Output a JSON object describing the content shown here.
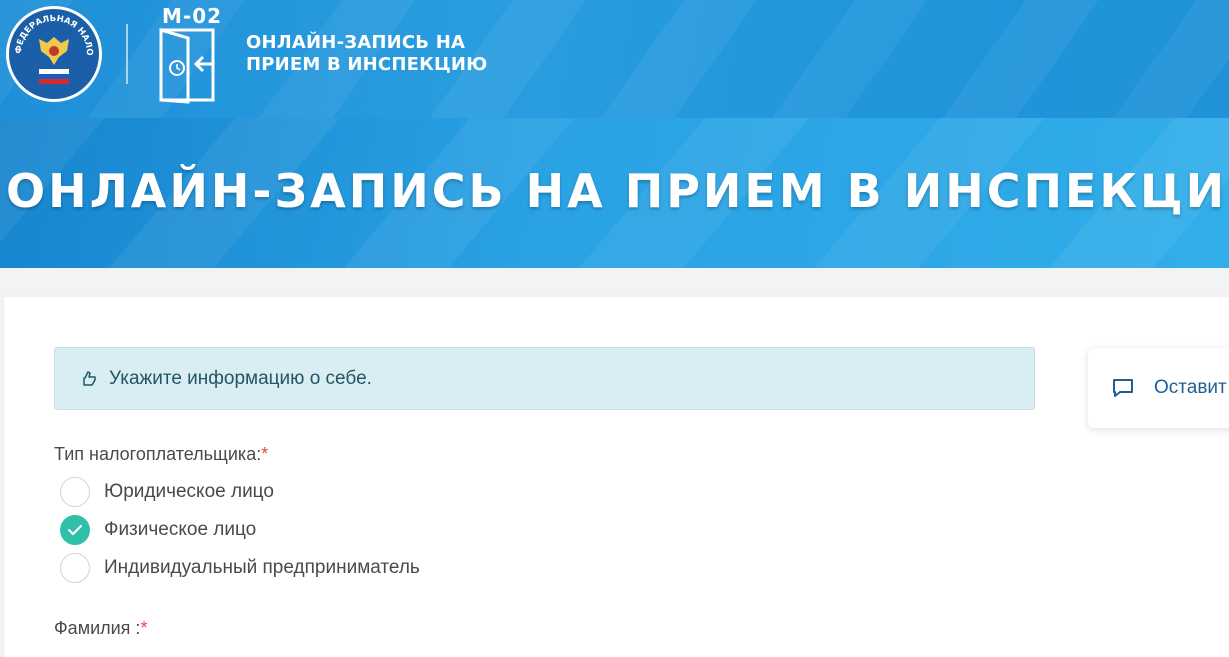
{
  "header": {
    "emblem_text": "ФЕДЕРАЛЬНАЯ НАЛОГОВАЯ СЛУЖБА",
    "service_code": "М-02",
    "service_name_line1": "ОНЛАЙН-ЗАПИСЬ НА",
    "service_name_line2": "ПРИЕМ В ИНСПЕКЦИЮ"
  },
  "banner": {
    "title": "ОНЛАЙН-ЗАПИСЬ НА ПРИЕМ В ИНСПЕКЦИЮ"
  },
  "form": {
    "info_message": "Укажите информацию о себе.",
    "taxpayer_type_label": "Тип налогоплательщика:",
    "required_mark": "*",
    "taxpayer_options": [
      {
        "label": "Юридическое лицо",
        "checked": false
      },
      {
        "label": "Физическое лицо",
        "checked": true
      },
      {
        "label": "Индивидуальный предприниматель",
        "checked": false
      }
    ],
    "surname_label": "Фамилия :"
  },
  "feedback": {
    "label": "Оставит"
  },
  "colors": {
    "header_blue": "#1e8fd8",
    "banner_blue": "#2aa2e4",
    "radio_checked": "#2ec0a8",
    "alert_bg": "#d8eef2",
    "required": "#e74c3c"
  },
  "icons": [
    "fns-emblem-icon",
    "door-entry-icon",
    "hand-pointing-icon",
    "chat-bubble-icon",
    "checkmark-icon"
  ]
}
